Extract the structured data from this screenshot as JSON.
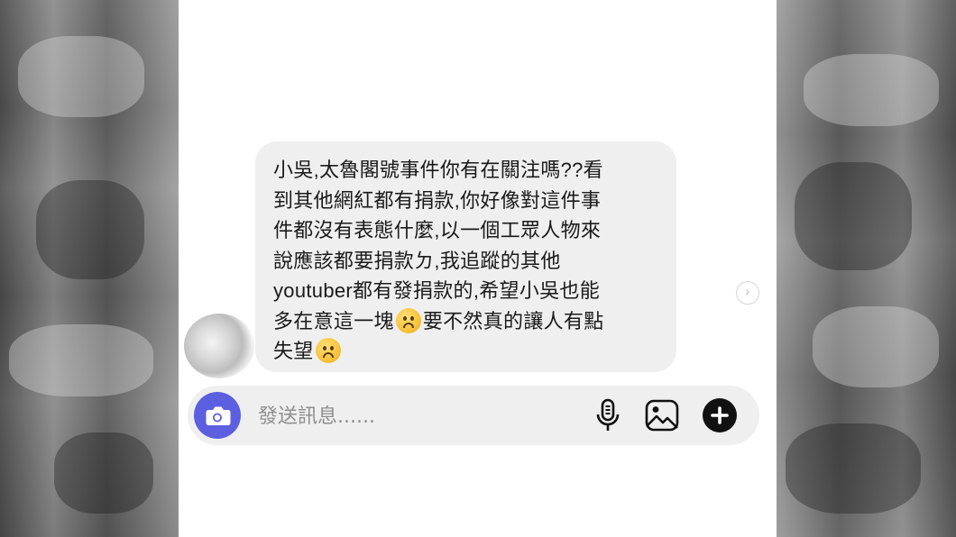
{
  "conversation": {
    "message_lines": [
      "小吳,太魯閣號事件你有在關注嗎??看",
      "到其他網紅都有捐款,你好像對這件事",
      "件都沒有表態什麼,以一個工眾人物來",
      "說應該都要捐款ㄉ,我追蹤的其他",
      "youtuber都有發捐款的,希望小吳也能"
    ],
    "line6_before": "多在意這一塊",
    "line6_after": "要不然真的讓人有點",
    "line7": "失望",
    "emoji": "frowning-face"
  },
  "composer": {
    "placeholder": "發送訊息......"
  },
  "icons": {
    "camera": "camera-icon",
    "mic": "microphone-icon",
    "gallery": "image-icon",
    "plus": "plus-icon",
    "next": "chevron-right-icon"
  },
  "colors": {
    "camera_button": "#5b5fe0",
    "bubble": "#efefef",
    "plus_button": "#111111"
  }
}
